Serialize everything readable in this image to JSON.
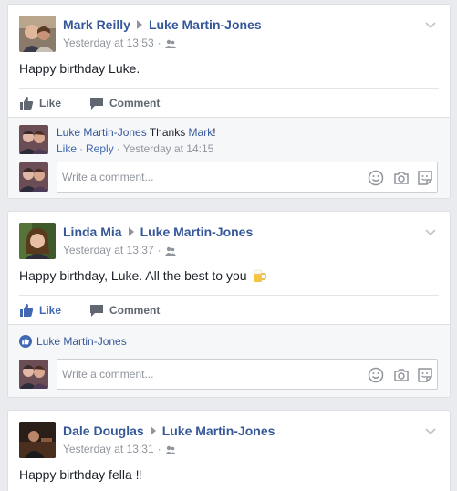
{
  "posts": [
    {
      "author": "Mark Reilly",
      "target": "Luke Martin-Jones",
      "time": "Yesterday at 13:53",
      "text": "Happy birthday Luke.",
      "like_label": "Like",
      "comment_label": "Comment",
      "liked": false,
      "reply": {
        "author": "Luke Martin-Jones",
        "text_before": "Thanks",
        "mention": "Mark",
        "text_after": "!",
        "like_link": "Like",
        "reply_link": "Reply",
        "time": "Yesterday at 14:15"
      },
      "composer_placeholder": "Write a comment..."
    },
    {
      "author": "Linda Mia",
      "target": "Luke Martin-Jones",
      "time": "Yesterday at 13:37",
      "text": "Happy birthday, Luke. All the best to you",
      "like_label": "Like",
      "comment_label": "Comment",
      "liked": true,
      "liked_by": "Luke Martin-Jones",
      "composer_placeholder": "Write a comment..."
    },
    {
      "author": "Dale Douglas",
      "target": "Luke Martin-Jones",
      "time": "Yesterday at 13:31",
      "text": "Happy birthday fella ‼"
    }
  ],
  "icons": {
    "audience": "friends-icon",
    "menu": "chevron-down-icon",
    "like": "thumbs-up-icon",
    "comment": "speech-bubble-icon",
    "emoji": "smiley-icon",
    "camera": "camera-icon",
    "sticker": "sticker-icon",
    "beer": "beer-mug-icon"
  },
  "colors": {
    "link": "#365899",
    "liked": "#4267b2",
    "meta": "#90949c",
    "background": "#e9ebee"
  }
}
